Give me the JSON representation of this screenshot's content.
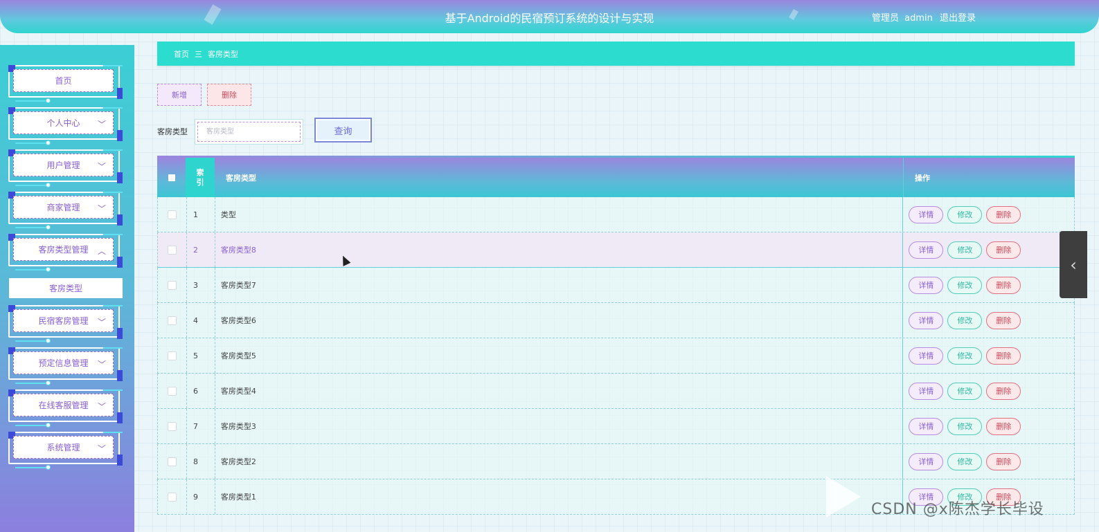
{
  "header": {
    "title": "基于Android的民宿预订系统的设计与实现",
    "role": "管理员",
    "username": "admin",
    "logout": "退出登录"
  },
  "sidebar": {
    "items": [
      {
        "label": "首页",
        "chevron": ""
      },
      {
        "label": "个人中心",
        "chevron": "chevron-down"
      },
      {
        "label": "用户管理",
        "chevron": "chevron-down"
      },
      {
        "label": "商家管理",
        "chevron": "chevron-down"
      },
      {
        "label": "客房类型管理",
        "chevron": "chevron-up"
      },
      {
        "label": "民宿客房管理",
        "chevron": "chevron-down"
      },
      {
        "label": "预定信息管理",
        "chevron": "chevron-down"
      },
      {
        "label": "在线客服管理",
        "chevron": "chevron-down"
      },
      {
        "label": "系统管理",
        "chevron": "chevron-down"
      }
    ],
    "active_sub": "客房类型"
  },
  "breadcrumb": {
    "home": "首页",
    "separator": "三",
    "current": "客房类型"
  },
  "actions": {
    "add": "新增",
    "delete": "删除"
  },
  "search": {
    "label": "客房类型",
    "placeholder": "客房类型",
    "value": "",
    "button": "查询"
  },
  "table": {
    "headers": {
      "index": "索引",
      "name": "客房类型",
      "ops": "操作"
    },
    "ops": {
      "detail": "详情",
      "edit": "修改",
      "delete": "删除"
    },
    "rows": [
      {
        "index": "1",
        "name": "类型"
      },
      {
        "index": "2",
        "name": "客房类型8"
      },
      {
        "index": "3",
        "name": "客房类型7"
      },
      {
        "index": "4",
        "name": "客房类型6"
      },
      {
        "index": "5",
        "name": "客房类型5"
      },
      {
        "index": "6",
        "name": "客房类型4"
      },
      {
        "index": "7",
        "name": "客房类型3"
      },
      {
        "index": "8",
        "name": "客房类型2"
      },
      {
        "index": "9",
        "name": "客房类型1"
      }
    ],
    "highlight_row": 2
  },
  "watermark": {
    "text": "CSDN @x陈杰学长毕设"
  },
  "colors": {
    "accent": "#2bdccf",
    "purple": "#8a5fd0",
    "danger": "#d04a5a"
  }
}
